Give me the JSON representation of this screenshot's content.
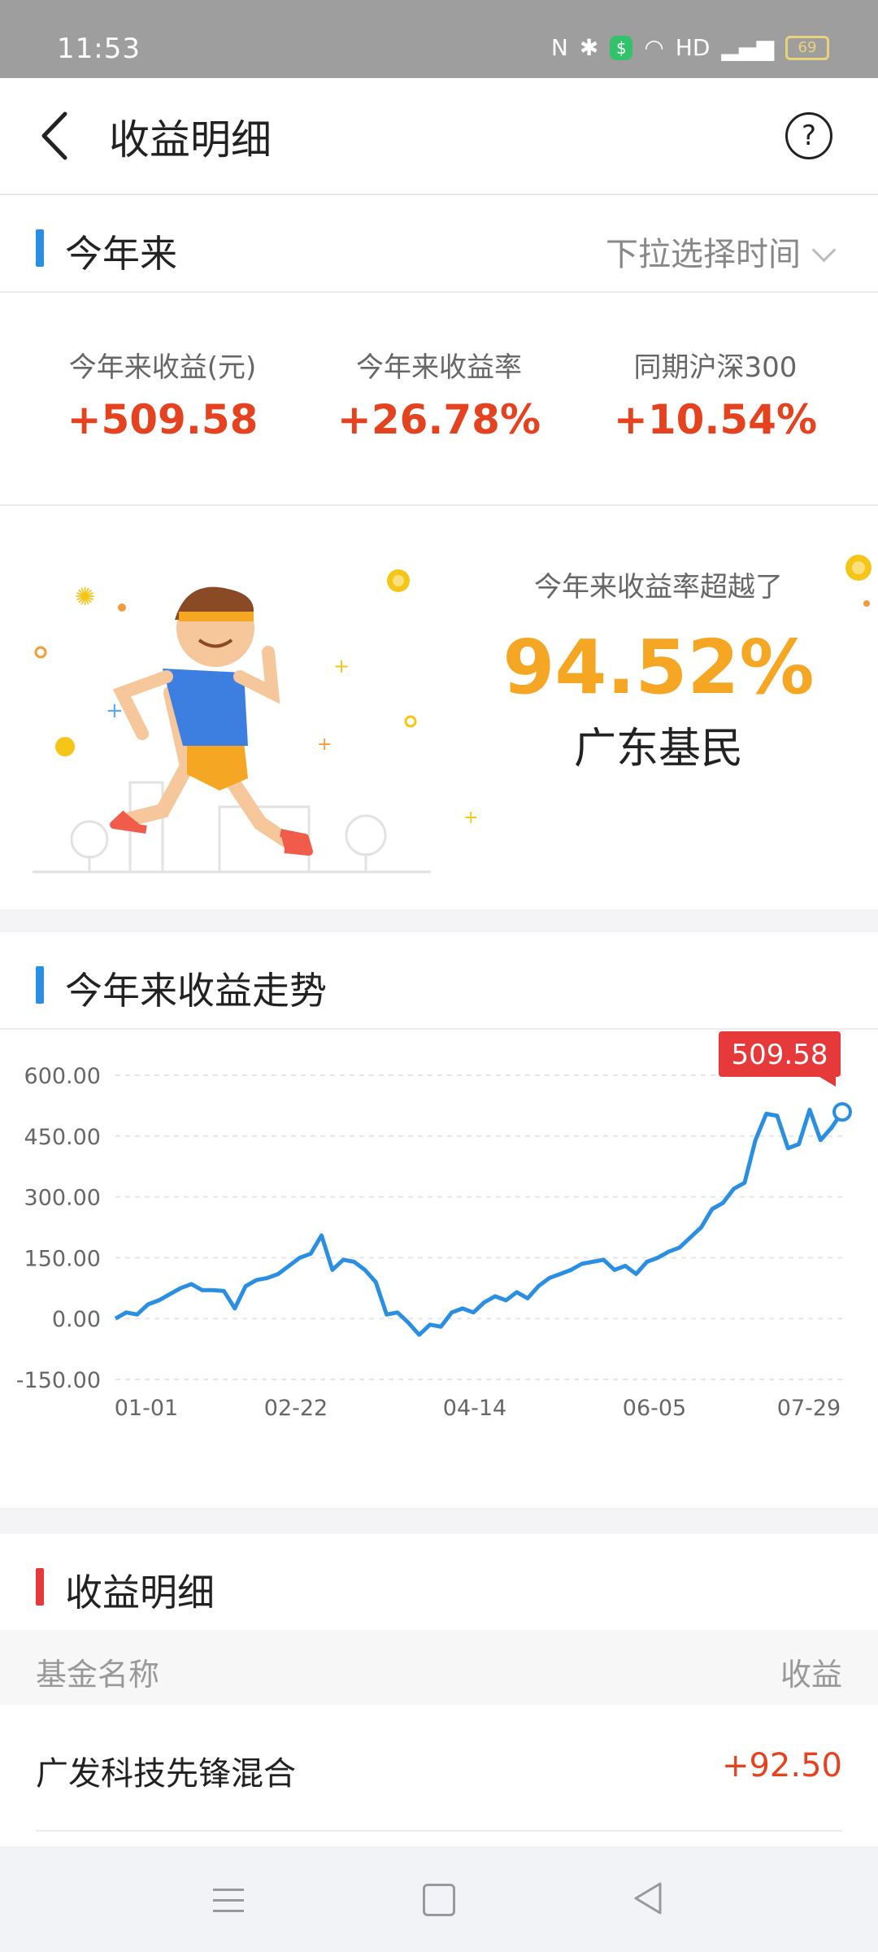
{
  "status": {
    "time": "11:53",
    "network": "HD",
    "battery": "69"
  },
  "header": {
    "title": "收益明细",
    "help": "?"
  },
  "ytd": {
    "title": "今年来",
    "filter_label": "下拉选择时间",
    "metrics": [
      {
        "label": "今年来收益(元)",
        "value": "+509.58"
      },
      {
        "label": "今年来收益率",
        "value": "+26.78%"
      },
      {
        "label": "同期沪深300",
        "value": "+10.54%"
      }
    ]
  },
  "hero": {
    "caption": "今年来收益率超越了",
    "percent": "94.52%",
    "subtitle": "广东基民"
  },
  "trend": {
    "title": "今年来收益走势",
    "badge": "509.58"
  },
  "chart_data": {
    "type": "line",
    "title": "",
    "ylim": [
      -150,
      600
    ],
    "yticks": [
      "600.00",
      "450.00",
      "300.00",
      "150.00",
      "0.00",
      "-150.00"
    ],
    "xticks": [
      "01-01",
      "02-22",
      "04-14",
      "06-05",
      "07-29"
    ],
    "series": [
      {
        "values": [
          0,
          15,
          10,
          35,
          45,
          60,
          75,
          85,
          70,
          70,
          68,
          25,
          80,
          95,
          100,
          110,
          130,
          150,
          160,
          205,
          120,
          145,
          140,
          120,
          90,
          10,
          15,
          -10,
          -40,
          -15,
          -20,
          15,
          25,
          15,
          40,
          55,
          45,
          65,
          50,
          80,
          100,
          110,
          120,
          135,
          140,
          145,
          120,
          130,
          110,
          140,
          150,
          165,
          175,
          200,
          225,
          270,
          285,
          320,
          335,
          440,
          505,
          500,
          420,
          430,
          515,
          440,
          470,
          509.58
        ]
      }
    ],
    "grid": true,
    "legend": "none"
  },
  "detail": {
    "title": "收益明细",
    "col_name": "基金名称",
    "col_amount": "收益",
    "rows": [
      {
        "name": "广发科技先锋混合",
        "amount": "+92.50"
      }
    ]
  },
  "colors": {
    "accent": "#2a8fe3",
    "up": "#e5431f",
    "hero": "#f5a623",
    "badge": "#e63a3a"
  }
}
